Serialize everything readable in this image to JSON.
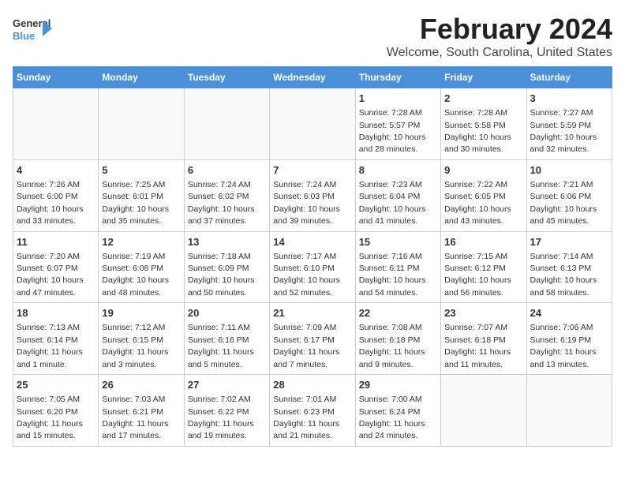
{
  "header": {
    "logo_general": "General",
    "logo_blue": "Blue",
    "title": "February 2024",
    "subtitle": "Welcome, South Carolina, United States"
  },
  "calendar": {
    "days_of_week": [
      "Sunday",
      "Monday",
      "Tuesday",
      "Wednesday",
      "Thursday",
      "Friday",
      "Saturday"
    ],
    "weeks": [
      [
        {
          "day": "",
          "info": ""
        },
        {
          "day": "",
          "info": ""
        },
        {
          "day": "",
          "info": ""
        },
        {
          "day": "",
          "info": ""
        },
        {
          "day": "1",
          "info": "Sunrise: 7:28 AM\nSunset: 5:57 PM\nDaylight: 10 hours and 28 minutes."
        },
        {
          "day": "2",
          "info": "Sunrise: 7:28 AM\nSunset: 5:58 PM\nDaylight: 10 hours and 30 minutes."
        },
        {
          "day": "3",
          "info": "Sunrise: 7:27 AM\nSunset: 5:59 PM\nDaylight: 10 hours and 32 minutes."
        }
      ],
      [
        {
          "day": "4",
          "info": "Sunrise: 7:26 AM\nSunset: 6:00 PM\nDaylight: 10 hours and 33 minutes."
        },
        {
          "day": "5",
          "info": "Sunrise: 7:25 AM\nSunset: 6:01 PM\nDaylight: 10 hours and 35 minutes."
        },
        {
          "day": "6",
          "info": "Sunrise: 7:24 AM\nSunset: 6:02 PM\nDaylight: 10 hours and 37 minutes."
        },
        {
          "day": "7",
          "info": "Sunrise: 7:24 AM\nSunset: 6:03 PM\nDaylight: 10 hours and 39 minutes."
        },
        {
          "day": "8",
          "info": "Sunrise: 7:23 AM\nSunset: 6:04 PM\nDaylight: 10 hours and 41 minutes."
        },
        {
          "day": "9",
          "info": "Sunrise: 7:22 AM\nSunset: 6:05 PM\nDaylight: 10 hours and 43 minutes."
        },
        {
          "day": "10",
          "info": "Sunrise: 7:21 AM\nSunset: 6:06 PM\nDaylight: 10 hours and 45 minutes."
        }
      ],
      [
        {
          "day": "11",
          "info": "Sunrise: 7:20 AM\nSunset: 6:07 PM\nDaylight: 10 hours and 47 minutes."
        },
        {
          "day": "12",
          "info": "Sunrise: 7:19 AM\nSunset: 6:08 PM\nDaylight: 10 hours and 48 minutes."
        },
        {
          "day": "13",
          "info": "Sunrise: 7:18 AM\nSunset: 6:09 PM\nDaylight: 10 hours and 50 minutes."
        },
        {
          "day": "14",
          "info": "Sunrise: 7:17 AM\nSunset: 6:10 PM\nDaylight: 10 hours and 52 minutes."
        },
        {
          "day": "15",
          "info": "Sunrise: 7:16 AM\nSunset: 6:11 PM\nDaylight: 10 hours and 54 minutes."
        },
        {
          "day": "16",
          "info": "Sunrise: 7:15 AM\nSunset: 6:12 PM\nDaylight: 10 hours and 56 minutes."
        },
        {
          "day": "17",
          "info": "Sunrise: 7:14 AM\nSunset: 6:13 PM\nDaylight: 10 hours and 58 minutes."
        }
      ],
      [
        {
          "day": "18",
          "info": "Sunrise: 7:13 AM\nSunset: 6:14 PM\nDaylight: 11 hours and 1 minute."
        },
        {
          "day": "19",
          "info": "Sunrise: 7:12 AM\nSunset: 6:15 PM\nDaylight: 11 hours and 3 minutes."
        },
        {
          "day": "20",
          "info": "Sunrise: 7:11 AM\nSunset: 6:16 PM\nDaylight: 11 hours and 5 minutes."
        },
        {
          "day": "21",
          "info": "Sunrise: 7:09 AM\nSunset: 6:17 PM\nDaylight: 11 hours and 7 minutes."
        },
        {
          "day": "22",
          "info": "Sunrise: 7:08 AM\nSunset: 6:18 PM\nDaylight: 11 hours and 9 minutes."
        },
        {
          "day": "23",
          "info": "Sunrise: 7:07 AM\nSunset: 6:18 PM\nDaylight: 11 hours and 11 minutes."
        },
        {
          "day": "24",
          "info": "Sunrise: 7:06 AM\nSunset: 6:19 PM\nDaylight: 11 hours and 13 minutes."
        }
      ],
      [
        {
          "day": "25",
          "info": "Sunrise: 7:05 AM\nSunset: 6:20 PM\nDaylight: 11 hours and 15 minutes."
        },
        {
          "day": "26",
          "info": "Sunrise: 7:03 AM\nSunset: 6:21 PM\nDaylight: 11 hours and 17 minutes."
        },
        {
          "day": "27",
          "info": "Sunrise: 7:02 AM\nSunset: 6:22 PM\nDaylight: 11 hours and 19 minutes."
        },
        {
          "day": "28",
          "info": "Sunrise: 7:01 AM\nSunset: 6:23 PM\nDaylight: 11 hours and 21 minutes."
        },
        {
          "day": "29",
          "info": "Sunrise: 7:00 AM\nSunset: 6:24 PM\nDaylight: 11 hours and 24 minutes."
        },
        {
          "day": "",
          "info": ""
        },
        {
          "day": "",
          "info": ""
        }
      ]
    ]
  }
}
